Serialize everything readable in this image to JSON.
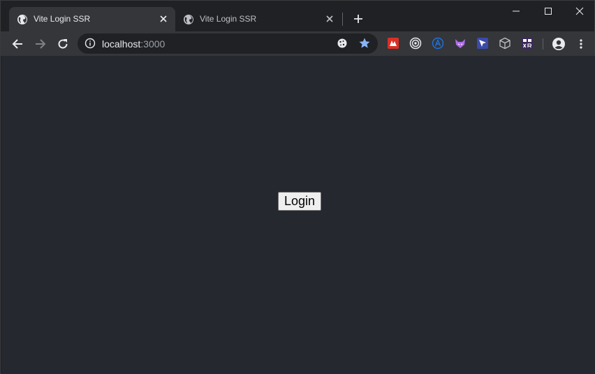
{
  "window": {
    "controls": {
      "minimize_icon": "minimize-icon",
      "maximize_icon": "maximize-icon",
      "close_icon": "close-icon"
    }
  },
  "tabs": [
    {
      "title": "Vite Login SSR",
      "active": true,
      "icon": "globe-icon"
    },
    {
      "title": "Vite Login SSR",
      "active": false,
      "icon": "globe-icon"
    }
  ],
  "toolbar": {
    "url_host": "localhost",
    "url_port": ":3000",
    "extensions": [
      "ext-red-icon",
      "target-icon",
      "a-circle-icon",
      "fox-icon",
      "cursor-icon",
      "cube-icon",
      "xr-icon"
    ]
  },
  "page": {
    "login_label": "Login",
    "background": "#262830"
  },
  "colors": {
    "chrome_dark": "#202124",
    "toolbar": "#35363a",
    "star": "#8ab4f8"
  }
}
